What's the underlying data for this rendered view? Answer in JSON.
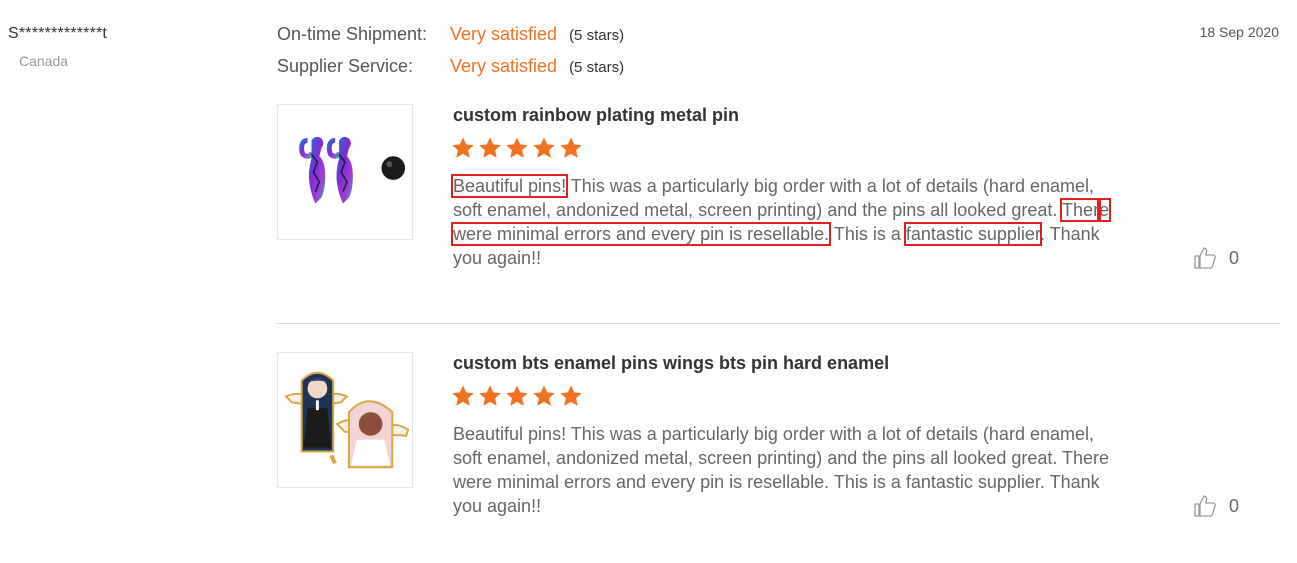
{
  "reviewer": {
    "name": "S*************t",
    "country": "Canada"
  },
  "date": "18 Sep 2020",
  "ratings": [
    {
      "label": "On-time Shipment:",
      "value": "Very satisfied",
      "stars": "(5 stars)"
    },
    {
      "label": "Supplier Service:",
      "value": "Very satisfied",
      "stars": "(5 stars)"
    }
  ],
  "colors": {
    "accent": "#f07122",
    "highlight": "#e02020",
    "text": "#666666"
  },
  "reviews": [
    {
      "title": "custom rainbow plating metal pin",
      "rating": 5,
      "text": [
        {
          "t": "Beautiful pins!",
          "hl": true
        },
        {
          "t": " This was a particularly big order with a lot of details (hard enamel, soft enamel, andonized metal, screen printing) and the pins all looked great. "
        },
        {
          "t": "Ther",
          "hl": true
        },
        {
          "t": "e were minimal errors and every pin is resellable.",
          "hl": true
        },
        {
          "t": " This is a "
        },
        {
          "t": "fantastic supplier",
          "hl": true
        },
        {
          "t": ". Thank you again!!"
        }
      ],
      "likes": "0",
      "image_icon": "rainbow-pin-earrings-image"
    },
    {
      "title": "custom bts enamel pins wings bts pin hard enamel",
      "rating": 5,
      "text": [
        {
          "t": "Beautiful pins! This was a particularly big order with a lot of details (hard enamel, soft enamel, andonized metal, screen printing) and the pins all looked great. There were minimal errors and every pin is resellable. This is a fantastic supplier. Thank you again!!"
        }
      ],
      "likes": "0",
      "image_icon": "bts-angel-enamel-pins-image"
    }
  ]
}
